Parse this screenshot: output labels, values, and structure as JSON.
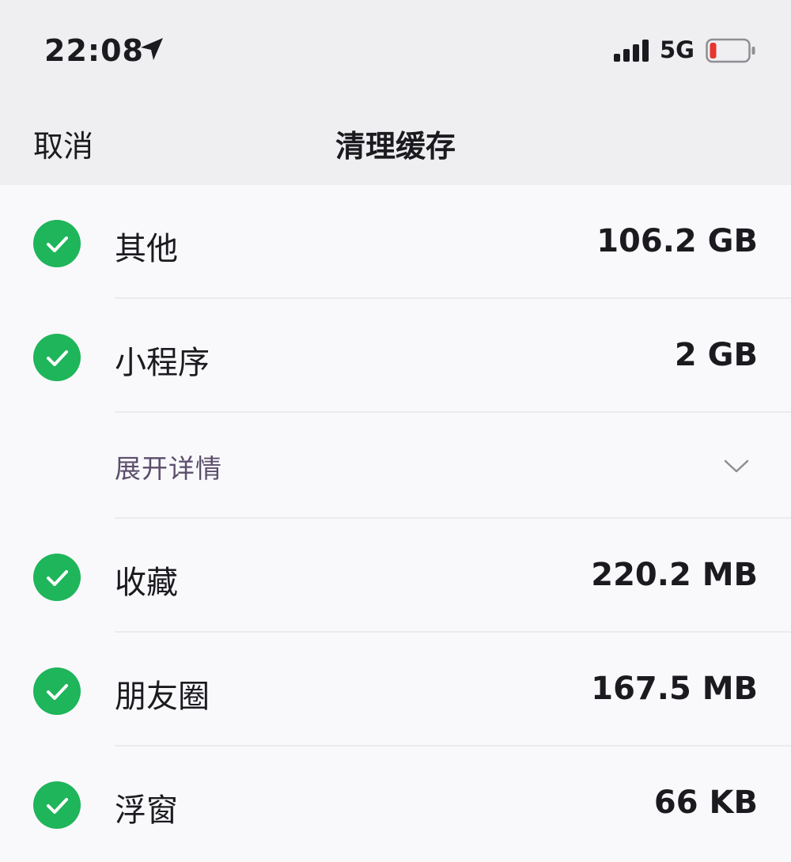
{
  "status_bar": {
    "time": "22:08",
    "network": "5G",
    "icons": [
      "location-arrow-icon",
      "signal-bars-icon",
      "battery-low-icon"
    ],
    "battery_color": "#e7352f"
  },
  "nav": {
    "cancel_label": "取消",
    "title": "清理缓存"
  },
  "items": [
    {
      "label": "其他",
      "size": "106.2 GB",
      "checked": true
    },
    {
      "label": "小程序",
      "size": "2 GB",
      "checked": true
    },
    {
      "label": "收藏",
      "size": "220.2 MB",
      "checked": true
    },
    {
      "label": "朋友圈",
      "size": "167.5 MB",
      "checked": true
    },
    {
      "label": "浮窗",
      "size": "66 KB",
      "checked": true
    }
  ],
  "expand": {
    "label": "展开详情",
    "icon": "chevron-down-icon"
  },
  "colors": {
    "check": "#1fb55a",
    "header_bg": "#efeff1",
    "list_bg": "#f9f9fc",
    "expand_text": "#5b4e6b"
  }
}
